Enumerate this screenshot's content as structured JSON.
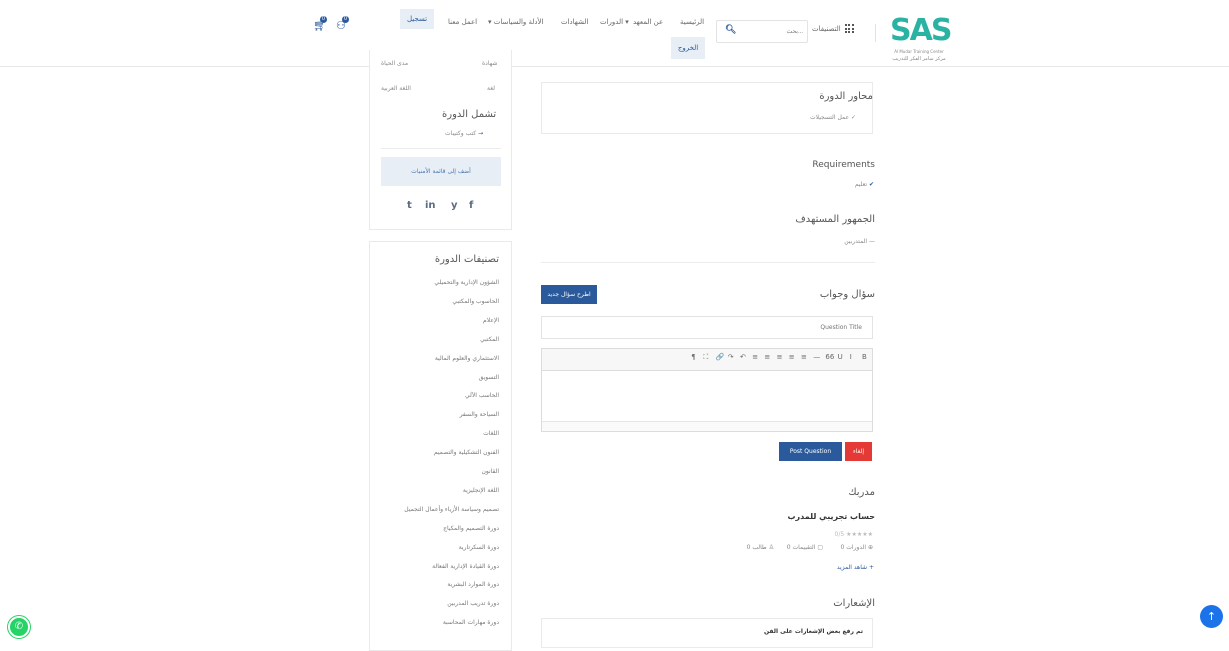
{
  "header": {
    "logo_text": "SAS",
    "logo_sub_en": "Al Mudar Training Center",
    "logo_sub_ar": "مركز سامر الفكر للتدريب",
    "categories_label": "التصنيفات",
    "search_placeholder": "بحث...",
    "nav": {
      "home": "الرئيسية",
      "about": "عن المعهد",
      "courses": "الدورات",
      "certificates": "الشهادات",
      "policies": "الأدلة والسياسات",
      "work": "اعمل معنا",
      "login": "تسجيل",
      "register": "الخروج"
    },
    "cart_count": "0",
    "user_count": "0"
  },
  "sidebar": {
    "info_rows": [
      {
        "label": "شهادة",
        "value": "مدى الحياة"
      },
      {
        "label": "لغة",
        "value": "اللغة العربية"
      }
    ],
    "includes_title": "تشمل الدورة",
    "includes_items": [
      "كتب وكتيبات"
    ],
    "wishlist_label": "أضف إلى قائمة الأمنيات",
    "social": [
      "t",
      "in",
      "y",
      "f"
    ],
    "categories_title": "تصنيفات الدورة",
    "categories": [
      "الشؤون الإدارية والتحميلي",
      "الحاسوب والمكتبي",
      "الإعلام",
      "المكتبي",
      "الاستثماري والعلوم المالية",
      "التسويق",
      "الحاسب الآلي",
      "السياحة والسفر",
      "اللغات",
      "الفنون التشكيلية والتصميم",
      "القانون",
      "اللغة الإنجليزية",
      "تصميم وسياسة الأزياء وأعمال التجميل",
      "دورة التصميم والمكياج",
      "دورة السكرتارية",
      "دورة القيادة الإدارية الفعالة",
      "دورة الموارد البشرية",
      "دورة تدريب المدربين",
      "دورة مهارات المحاسبة"
    ]
  },
  "main": {
    "curriculum_title": "محاور الدورة",
    "curriculum_item": "عمل التسجيلات",
    "requirements_title": "Requirements",
    "requirements_item": "تعليم",
    "audience_title": "الجمهور المستهدف",
    "audience_item": "المتدربين",
    "qa_title": "سؤال وجواب",
    "ask_button": "اطرح سؤال جديد",
    "question_placeholder": "Question Title",
    "editor_tools": [
      "B",
      "I",
      "U",
      "66",
      "—",
      "≡",
      "≡",
      "≡",
      "≡",
      "≡",
      "↶",
      "↷",
      "🔗",
      "⛶",
      "¶"
    ],
    "post_button": "Post Question",
    "cancel_button": "إلغاء",
    "instructor_title": "مدربك",
    "instructor_name": "حساب تجريبي للمدرب",
    "rating_text": "0/5 ★★★★★",
    "instructor_stats": [
      "0 الدورات",
      "0 التقييمات",
      "0 طالب"
    ],
    "view_more": "شاهد المزيد",
    "notifications_title": "الإشعارات",
    "notification_text": "تم رفع بعض الإشعارات على الفن"
  },
  "colors": {
    "primary": "#2a5a9b",
    "teal": "#2ab3a3",
    "danger": "#e53935",
    "light_blue_bg": "#e8eef5",
    "whatsapp": "#25d366",
    "scroll_top": "#1a73e8"
  }
}
